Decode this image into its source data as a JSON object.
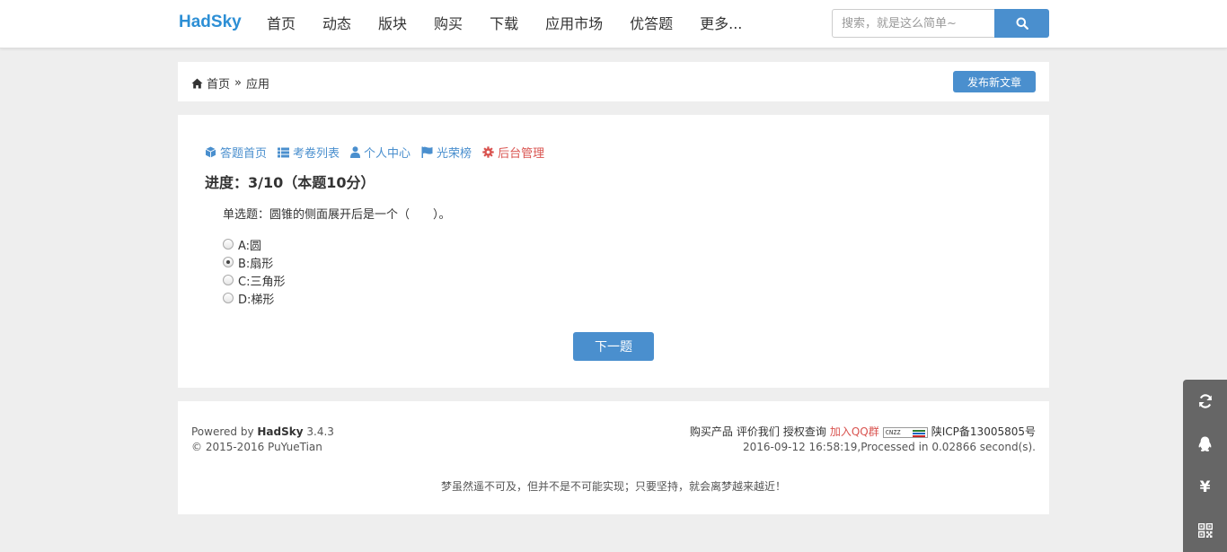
{
  "nav": {
    "brand": "HadSky",
    "items": [
      "首页",
      "动态",
      "版块",
      "购买",
      "下载",
      "应用市场",
      "优答题",
      "更多..."
    ],
    "search_placeholder": "搜索，就是这么简单~"
  },
  "breadcrumb": {
    "home": "首页",
    "separator": "»",
    "current": "应用",
    "publish_label": "发布新文章"
  },
  "quiz": {
    "subnav": [
      "答题首页",
      "考卷列表",
      "个人中心",
      "光荣榜",
      "后台管理"
    ],
    "progress": "进度：3/10（本题10分）",
    "question": "单选题：圆锥的侧面展开后是一个（　　）。",
    "options": [
      "A:圆",
      "B:扇形",
      "C:三角形",
      "D:梯形"
    ],
    "selected_index": 1,
    "next_label": "下一题"
  },
  "footer": {
    "powered_prefix": "Powered by ",
    "powered_name": "HadSky",
    "version": " 3.4.3",
    "copyright": "© 2015-2016 PuYueTian",
    "links": [
      "购买产品",
      "评价我们",
      "授权查询",
      "加入QQ群"
    ],
    "cnzz_label": "CNZZ",
    "icp": "陕ICP备13005805号",
    "timestamp": "2016-09-12 16:58:19,Processed in 0.02866 second(s).",
    "motto": "梦虽然遥不可及，但并不是不可能实现；只要坚持，就会离梦越来越近！"
  },
  "sidebar": {
    "yuan_symbol": "¥"
  },
  "colors": {
    "accent": "#4a8fce",
    "brand": "#2d8fd5",
    "danger": "#d9534f",
    "page_bg": "#eeeeee",
    "sidebar_bg": "#666666"
  }
}
